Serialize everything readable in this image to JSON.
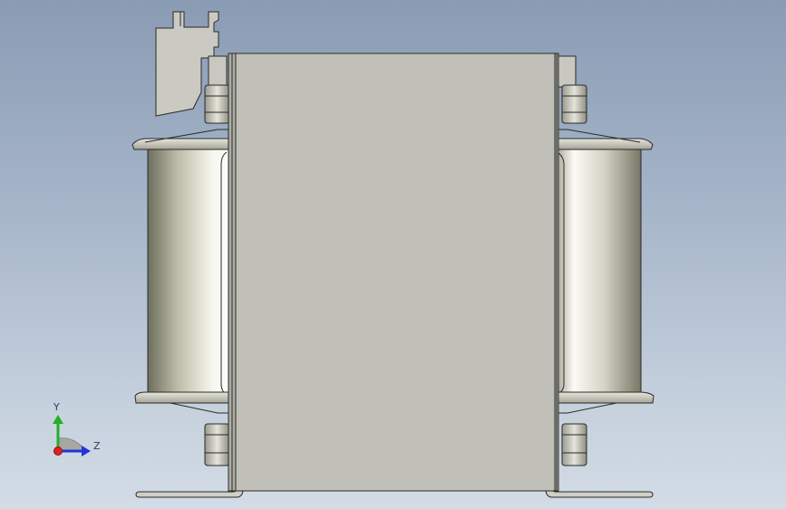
{
  "viewport": {
    "background_top": "#8a9bb4",
    "background_bottom": "#d3dce6"
  },
  "model": {
    "part_color": "#c0c0b8",
    "edge_color": "#2a2a2a"
  },
  "triad": {
    "y_label": "Y",
    "z_label": "Z",
    "y_color": "#22b022",
    "z_color": "#2035d8",
    "x_color": "#e02020"
  }
}
